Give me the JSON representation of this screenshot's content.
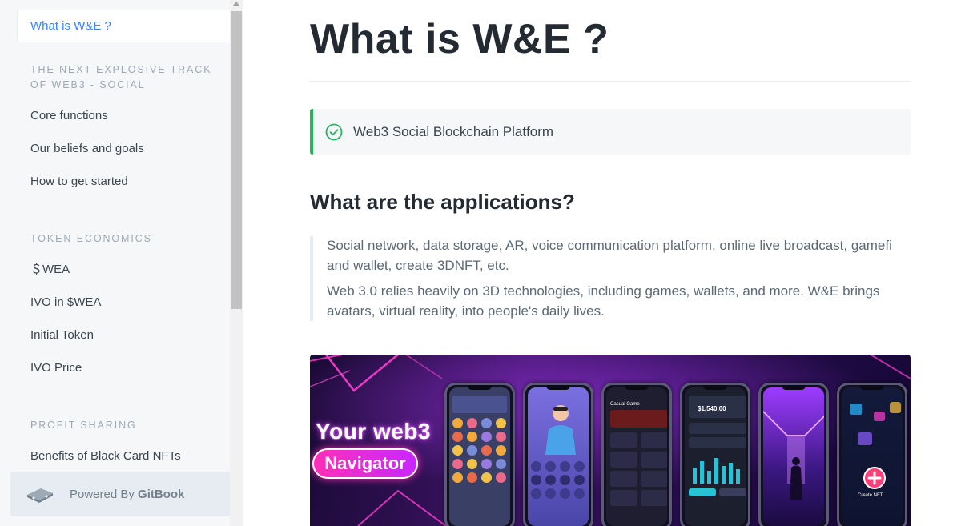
{
  "sidebar": {
    "active_item": "What is W&E ?",
    "sections": [
      {
        "title": "THE NEXT EXPLOSIVE TRACK OF WEB3 - SOCIAL",
        "items": [
          "Core functions",
          "Our beliefs and goals",
          "How to get started"
        ]
      },
      {
        "title": "TOKEN ECONOMICS",
        "items": [
          "＄WEA",
          "IVO in $WEA",
          "Initial Token",
          "IVO Price"
        ]
      },
      {
        "title": "PROFIT SHARING",
        "items": [
          "Benefits of Black Card NFTs"
        ]
      }
    ],
    "powered_by": {
      "prefix": "Powered By ",
      "brand": "GitBook"
    }
  },
  "main": {
    "title": "What is W&E ?",
    "hint": "Web3 Social Blockchain Platform",
    "heading": "What are the applications?",
    "quote": [
      "Social network, data storage, AR, voice communication platform, online live broadcast, gamefi and wallet, create 3DNFT, etc.",
      "Web 3.0 relies heavily on 3D technologies, including games, wallets, and more. W&E brings avatars, virtual reality, into people's daily lives."
    ],
    "hero": {
      "headline": "Your web3",
      "pill": "Navigator",
      "phone_labels": {
        "casual_game": "Casual Game",
        "balance": "$1,540.00",
        "create_nft": "Create NFT"
      }
    }
  },
  "colors": {
    "accent": "#3884ff",
    "hint_border": "#26b260",
    "sidebar_bg": "#f5f7f9",
    "title": "#242a31",
    "hero_pink": "#ff2fb7"
  },
  "icons": [
    "check-circle-icon",
    "gitbook-icon",
    "scroll-up-arrow-icon"
  ]
}
